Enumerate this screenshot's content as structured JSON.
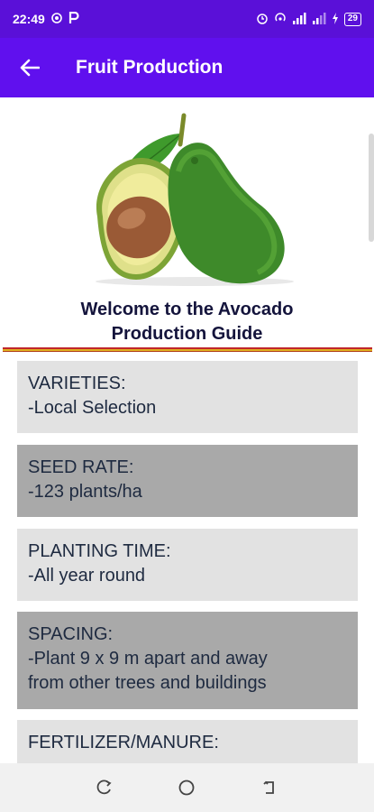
{
  "status_bar": {
    "time": "22:49",
    "left_icons": [
      "sync-icon",
      "parking-icon"
    ],
    "right_icons": [
      "alarm-icon",
      "hotspot-icon",
      "signal-icon",
      "signal-icon",
      "charging-icon"
    ],
    "battery": "29"
  },
  "app_bar": {
    "title": "Fruit Production",
    "back_icon": "arrow-left-icon"
  },
  "hero": {
    "image": "avocado-image",
    "welcome_line1": "Welcome to the Avocado",
    "welcome_line2": "Production Guide"
  },
  "cards": [
    {
      "heading": "VARIETIES:",
      "lines": [
        "-Local Selection"
      ],
      "shade": "light"
    },
    {
      "heading": "SEED RATE:",
      "lines": [
        "-123 plants/ha"
      ],
      "shade": "dark"
    },
    {
      "heading": "PLANTING TIME:",
      "lines": [
        "-All year round"
      ],
      "shade": "light"
    },
    {
      "heading": "SPACING:",
      "lines": [
        "-Plant 9 x 9 m apart and away",
        "from other trees and buildings"
      ],
      "shade": "dark"
    },
    {
      "heading": "FERTILIZER/MANURE:",
      "lines": [],
      "shade": "light"
    }
  ],
  "nav_bar": {
    "items": [
      "recent-apps-icon",
      "home-icon",
      "back-icon"
    ]
  },
  "colors": {
    "status_bar": "#5a10d8",
    "app_bar": "#6010ee",
    "card_light": "#e2e2e2",
    "card_dark": "#a9a9a9",
    "text_dark": "#14143c"
  }
}
